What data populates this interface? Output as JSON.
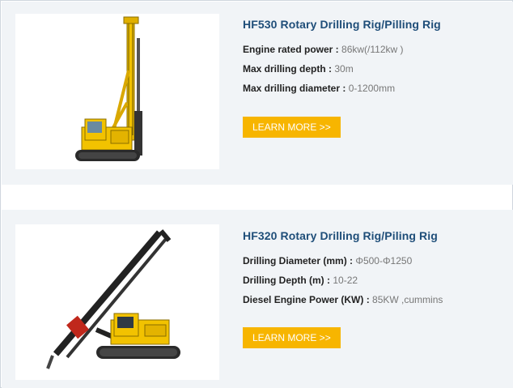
{
  "products": [
    {
      "title": "HF530 Rotary Drilling Rig/Pilling Rig",
      "image_icon": "drilling-rig-upright-illustration",
      "specs": [
        {
          "label": "Engine rated power :",
          "value": "86kw(/112kw )"
        },
        {
          "label": "Max drilling depth :",
          "value": "30m"
        },
        {
          "label": "Max drilling diameter :",
          "value": "0-1200mm"
        }
      ],
      "button_label": "LEARN MORE >>"
    },
    {
      "title": "HF320 Rotary Drilling Rig/Piling Rig",
      "image_icon": "drilling-rig-tilted-illustration",
      "specs": [
        {
          "label": "Drilling Diameter (mm) :",
          "value": "Φ500-Φ1250"
        },
        {
          "label": "Drilling Depth (m) :",
          "value": "10-22"
        },
        {
          "label": "Diesel Engine Power (KW) :",
          "value": "85KW ,cummins"
        }
      ],
      "button_label": "LEARN MORE >>"
    }
  ],
  "colors": {
    "title": "#1f4e79",
    "button": "#f7b500",
    "card_bg": "#f1f4f7",
    "machine_yellow": "#f2c200"
  }
}
